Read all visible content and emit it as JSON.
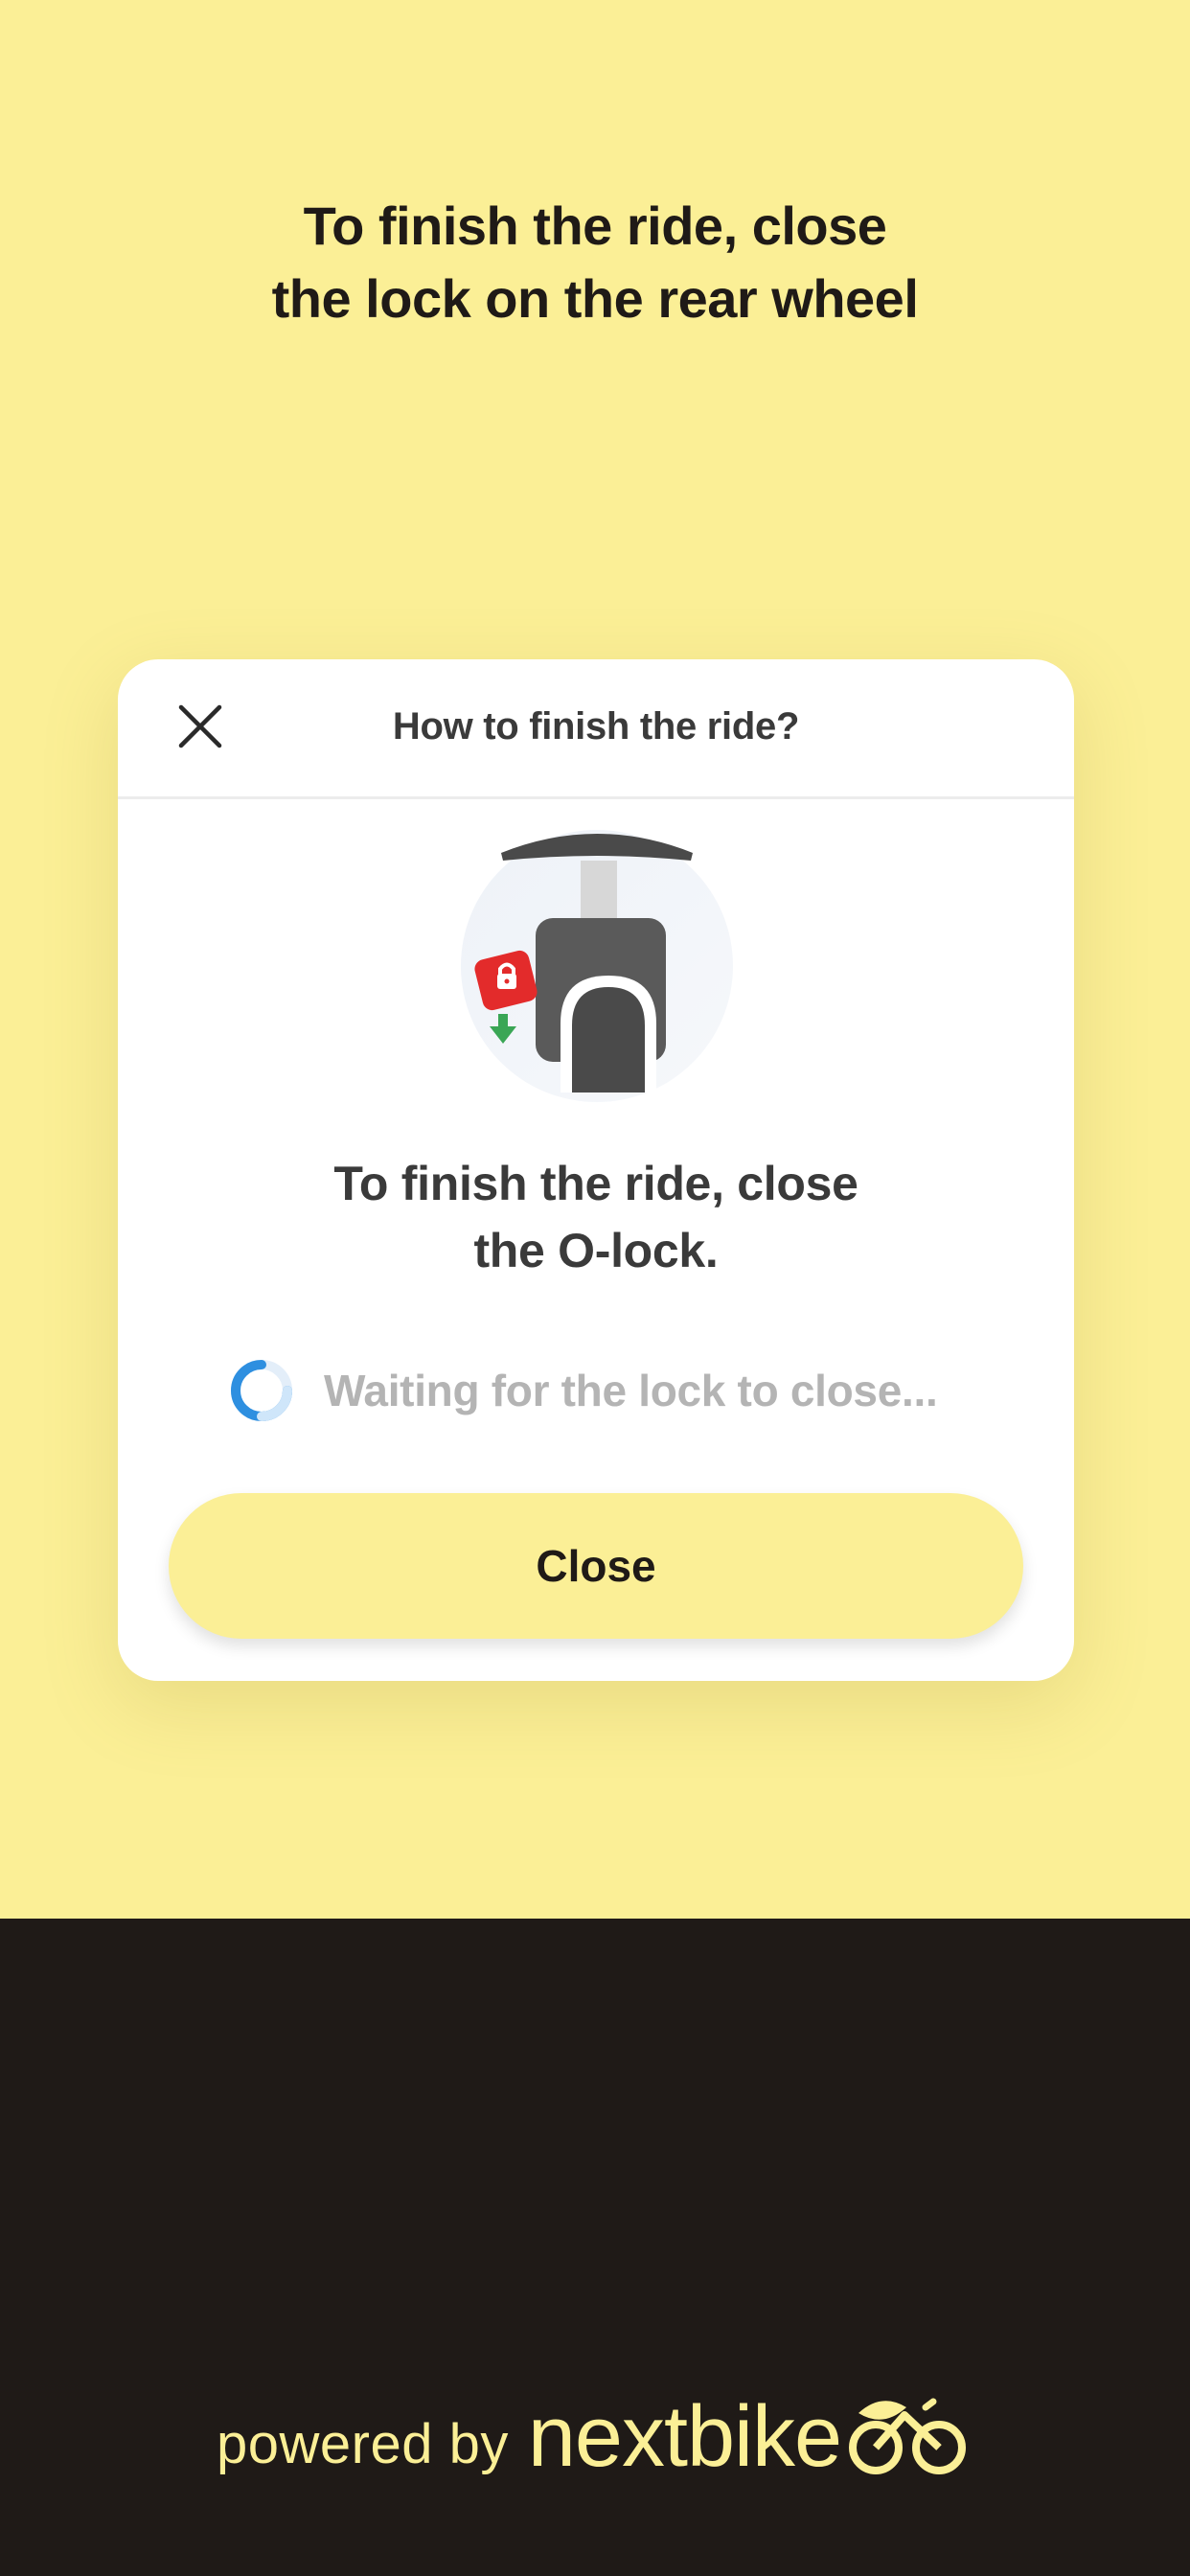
{
  "headline": {
    "line1": "To finish the ride, close",
    "line2": "the lock on the rear wheel"
  },
  "dialog": {
    "title": "How to finish the ride?",
    "close_icon": "close-icon",
    "illustration_icon": "o-lock-illustration",
    "instruction_line1": "To finish the ride, close",
    "instruction_line2": "the O-lock.",
    "waiting_text": "Waiting for the lock to close...",
    "close_button_label": "Close"
  },
  "footer": {
    "powered_by": "powered by",
    "brand": "nextbike",
    "brand_icon": "bike-leaf-icon"
  },
  "colors": {
    "background_yellow": "#fbef96",
    "dark": "#1f1a17",
    "lock_red": "#e32b2b",
    "arrow_green": "#3aa655",
    "spinner_blue": "#2e8fe0"
  }
}
